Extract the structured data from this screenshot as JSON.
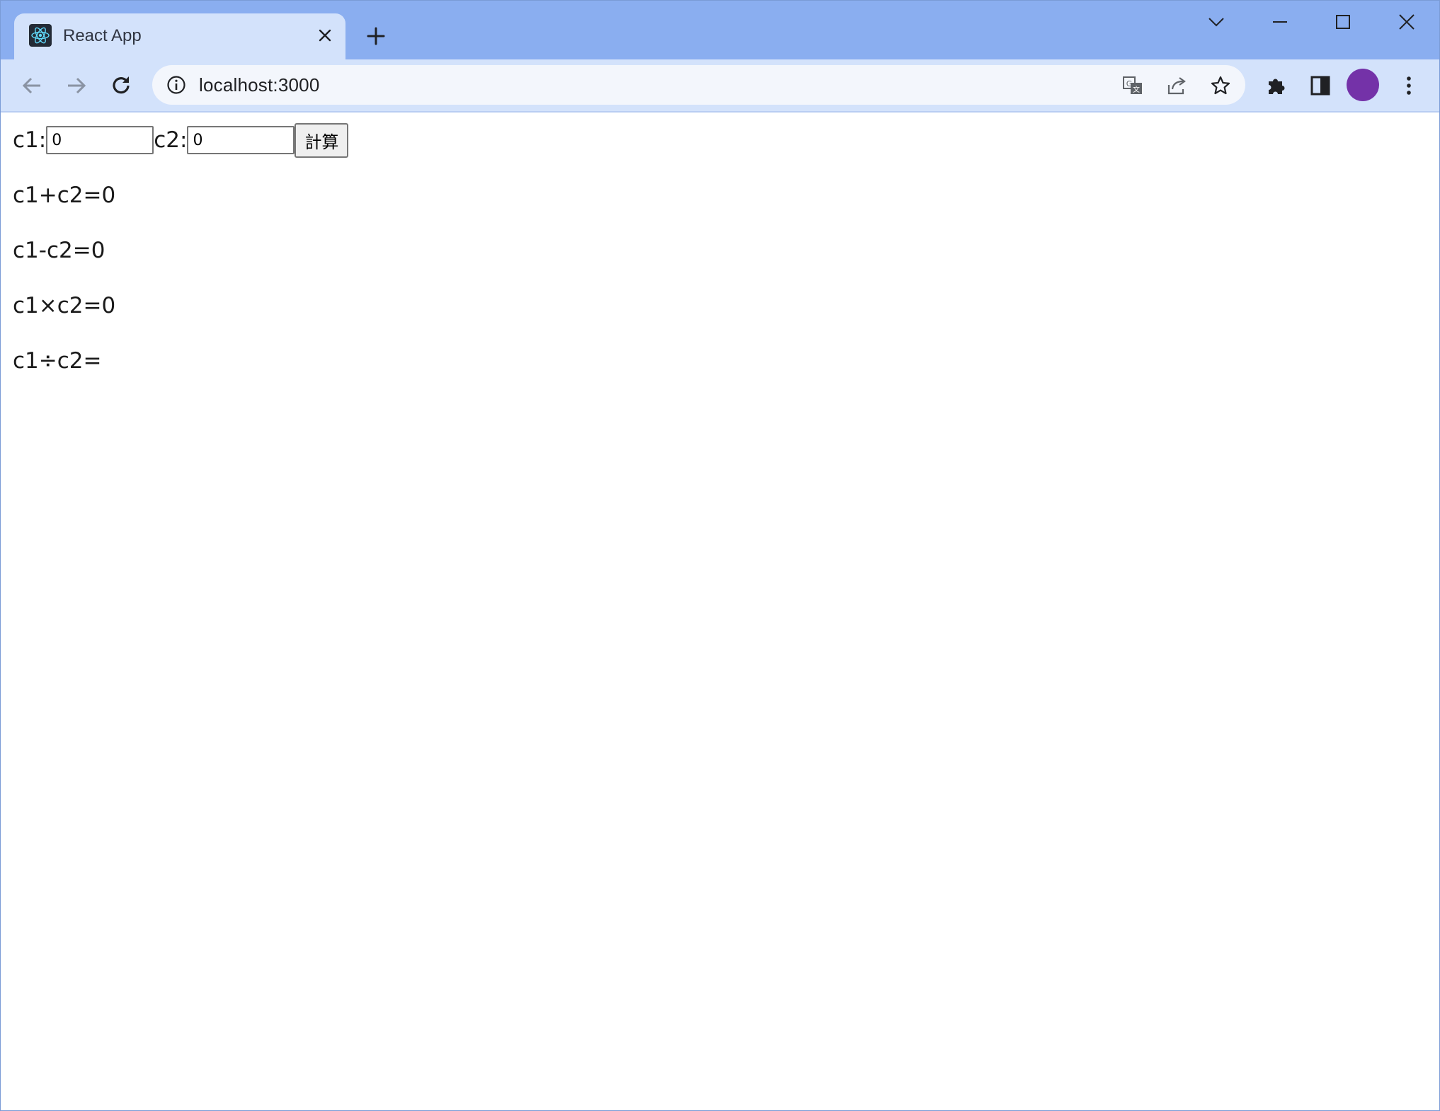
{
  "browser": {
    "tab": {
      "title": "React App",
      "favicon": "react-icon"
    },
    "address_bar": {
      "url": "localhost:3000"
    },
    "icons": {
      "back": "back-arrow-icon",
      "forward": "forward-arrow-icon",
      "reload": "reload-icon",
      "info": "info-icon",
      "translate": "translate-icon",
      "share": "share-icon",
      "bookmark": "star-icon",
      "extensions": "puzzle-icon",
      "side_panel": "side-panel-icon",
      "menu": "more-vert-icon"
    },
    "avatar_color": "#7432a8",
    "tabstrip_color": "#8aaef0",
    "toolbar_color": "#d3e2fb"
  },
  "form": {
    "c1_label": "c1:",
    "c1_value": "0",
    "c2_label": "c2:",
    "c2_value": "0",
    "calc_button": "計算"
  },
  "results": {
    "add": "c1+c2=0",
    "subtract": "c1-c2=0",
    "multiply": "c1×c2=0",
    "divide": "c1÷c2="
  }
}
